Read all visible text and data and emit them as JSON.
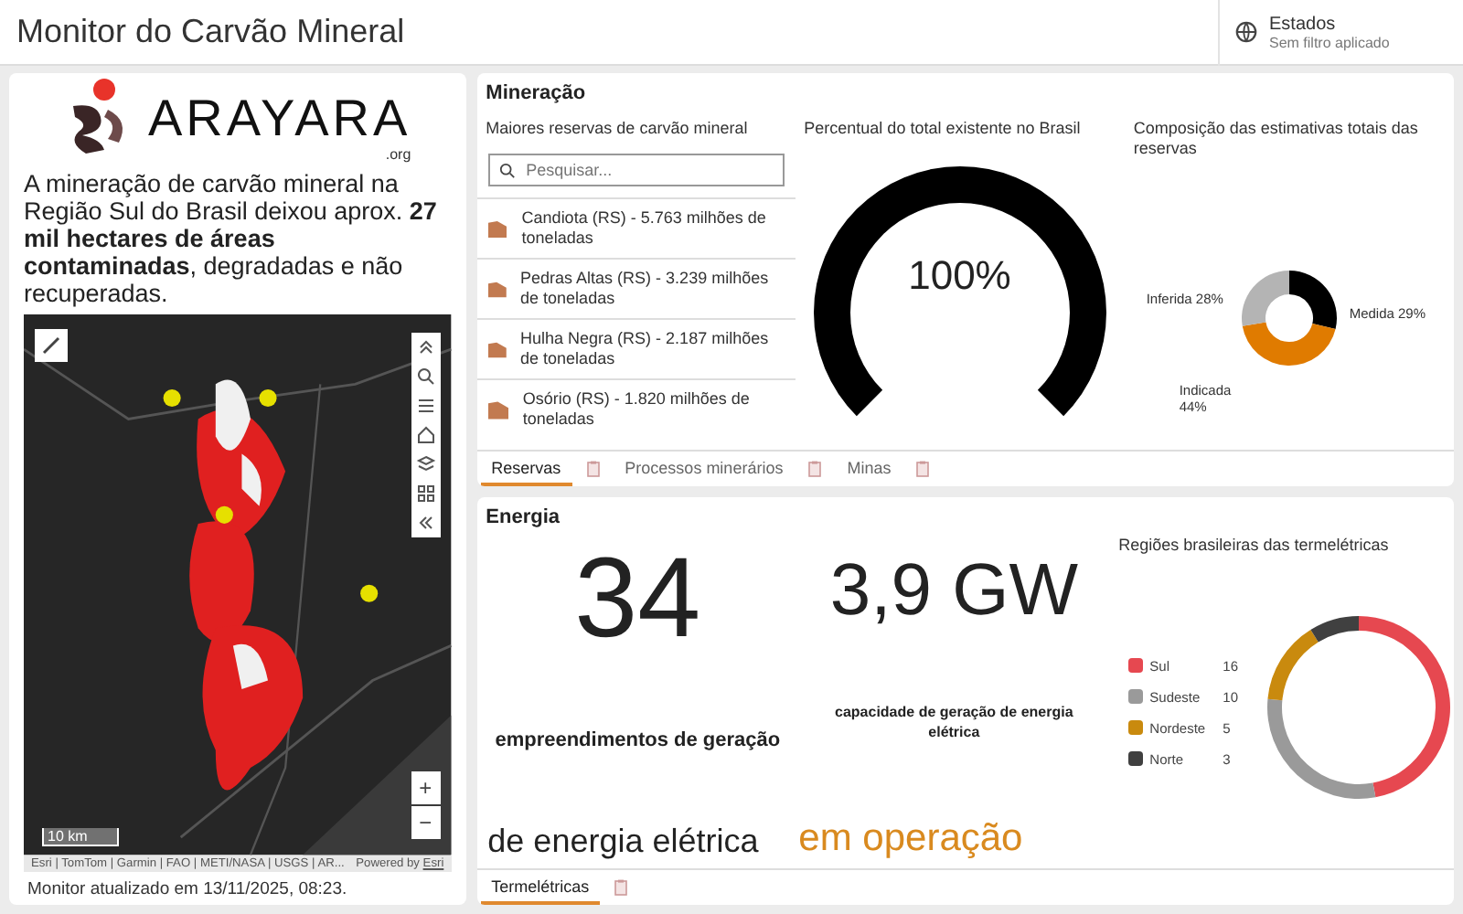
{
  "header": {
    "title": "Monitor do Carvão Mineral",
    "filter": {
      "label": "Estados",
      "value": "Sem filtro aplicado"
    }
  },
  "intro": {
    "logo": {
      "name": "ARAYARA",
      "suffix": ".org"
    },
    "text": "A mineração de carvão mineral na Região Sul do Brasil deixou aprox. **27 mil hectares de áreas contaminadas**, degradadas e não recuperadas.",
    "map": {
      "kind": "picture",
      "scale": "10 km",
      "attribution": "Esri | TomTom | Garmin | FAO | METI/NASA | USGS | AR...",
      "powered": "Powered by",
      "powered_link": "Esri",
      "zoom_in": "+",
      "zoom_out": "−"
    },
    "footer": "Monitor atualizado em 13/11/2025, 08:23."
  },
  "mineracao": {
    "title": "Mineração",
    "list_title": "Maiores reservas de carvão mineral",
    "search": {
      "placeholder": "Pesquisar..."
    },
    "reserves": [
      {
        "text": "Candiota (RS) - 5.763 milhões de toneladas"
      },
      {
        "text": "Pedras Altas (RS) - 3.239 milhões de toneladas"
      },
      {
        "text": "Hulha Negra (RS) - 2.187 milhões de toneladas"
      },
      {
        "text": "Osório (RS) - 1.820 milhões de toneladas"
      }
    ],
    "gauge": {
      "title": "Percentual do total existente no Brasil",
      "reading": "100%"
    },
    "composition": {
      "title": "Composição das estimativas totais das reservas",
      "chart_data": {
        "type": "donut",
        "categories": [
          "Medida 29%",
          "Indicada 44%",
          "Inferida 28%"
        ],
        "values": [
          29,
          44,
          28
        ],
        "colors": [
          "#000000",
          "#e07b00",
          "#b4b4b4"
        ]
      }
    },
    "tabs": [
      {
        "label": "Reservas",
        "selected": true
      },
      {
        "label": "Processos minerários",
        "selected": false
      },
      {
        "label": "Minas",
        "selected": false
      }
    ]
  },
  "energia": {
    "title": "Energia",
    "count": "34",
    "count_label": "empreendimentos de geração",
    "count_sub": "de energia elétrica",
    "capacity": "3,9 GW",
    "capacity_label": "capacidade de geração de energia elétrica",
    "status": "em operação",
    "regions": {
      "title": "Regiões brasileiras das termelétricas",
      "chart_data": {
        "type": "donut",
        "categories": [
          "Sul",
          "Sudeste",
          "Nordeste",
          "Norte"
        ],
        "values": [
          16,
          10,
          5,
          3
        ],
        "value_labels": [
          "16",
          "10",
          "5",
          "3"
        ],
        "colors": [
          "#e64850",
          "#9a9a9a",
          "#c98a0e",
          "#404040"
        ],
        "legend": "left"
      }
    },
    "tabs": [
      {
        "label": "Termelétricas",
        "selected": true
      }
    ]
  }
}
